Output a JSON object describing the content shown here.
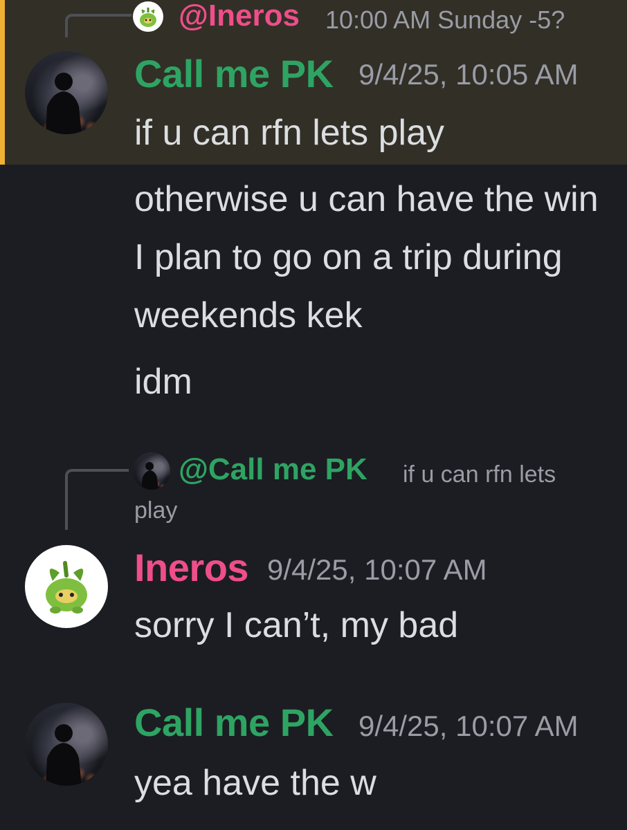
{
  "messages": [
    {
      "reply": {
        "mention": "@Ineros",
        "text": "10:00 AM Sunday -5?"
      },
      "author": "Call me PK",
      "timestamp": "9/4/25, 10:05 AM",
      "lines": [
        "if u can rfn lets play",
        "otherwise u can have the win I plan to go on a trip during weekends kek",
        "idm"
      ]
    },
    {
      "reply": {
        "mention": "@Call me PK",
        "text_line1": "if u can rfn lets",
        "text_line2": "play"
      },
      "author": "Ineros",
      "timestamp": "9/4/25, 10:07 AM",
      "lines": [
        "sorry I can’t, my bad"
      ]
    },
    {
      "author": "Call me PK",
      "timestamp": "9/4/25, 10:07 AM",
      "lines": [
        "yea have the w"
      ]
    }
  ],
  "colors": {
    "background": "#1c1d22",
    "highlight": "#322f27",
    "highlight_bar": "#f0b232",
    "author_pk": "#2ea463",
    "author_ineros": "#ee4e8a"
  },
  "icons": {
    "avatar_pk": "night-city-silhouette-avatar",
    "avatar_ineros": "green-sprout-creature-avatar"
  }
}
